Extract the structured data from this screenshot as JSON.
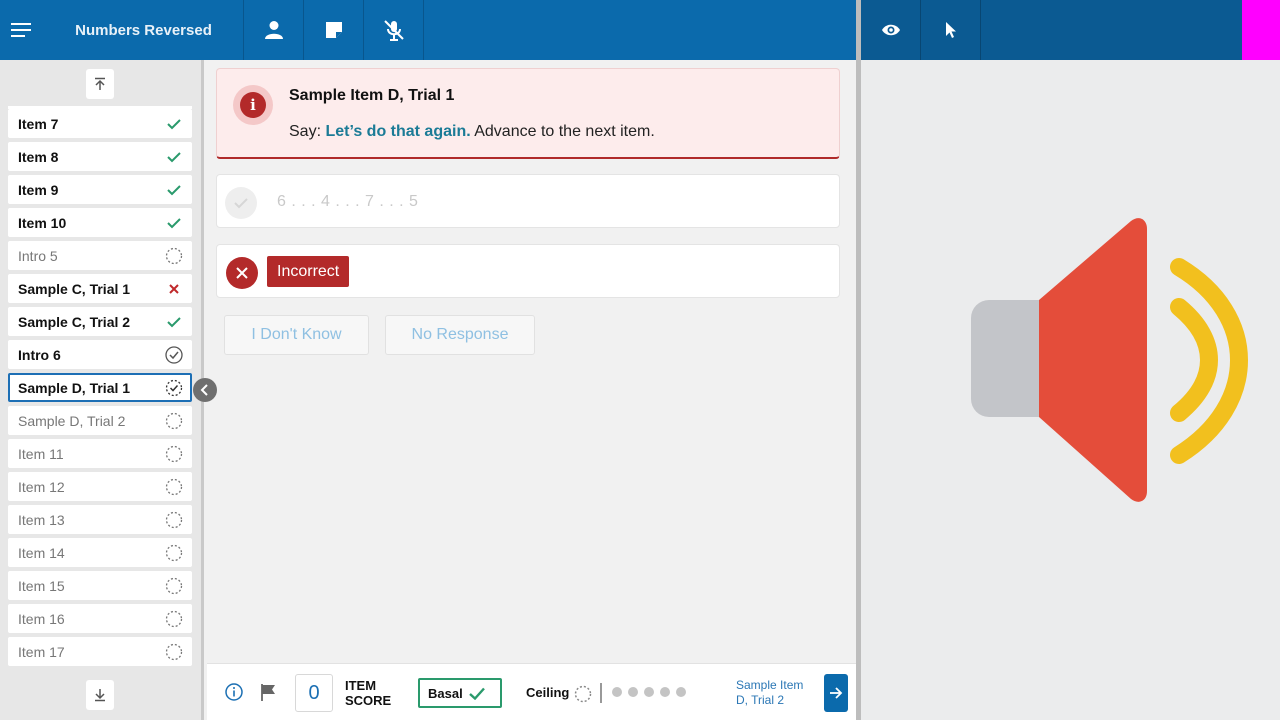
{
  "header": {
    "title": "Numbers Reversed"
  },
  "sidebar": {
    "items": [
      {
        "label": "Item 7",
        "status": "check",
        "style": "bold"
      },
      {
        "label": "Item 8",
        "status": "check",
        "style": "bold"
      },
      {
        "label": "Item 9",
        "status": "check",
        "style": "bold"
      },
      {
        "label": "Item 10",
        "status": "check",
        "style": "bold"
      },
      {
        "label": "Intro 5",
        "status": "pending",
        "style": "muted"
      },
      {
        "label": "Sample C, Trial 1",
        "status": "cross",
        "style": "bold"
      },
      {
        "label": "Sample C, Trial 2",
        "status": "check",
        "style": "bold"
      },
      {
        "label": "Intro 6",
        "status": "check-circle",
        "style": "bold"
      },
      {
        "label": "Sample D, Trial 1",
        "status": "in-progress",
        "style": "bold current"
      },
      {
        "label": "Sample D, Trial 2",
        "status": "pending",
        "style": "muted"
      },
      {
        "label": "Item 11",
        "status": "pending",
        "style": "muted"
      },
      {
        "label": "Item 12",
        "status": "pending",
        "style": "muted"
      },
      {
        "label": "Item 13",
        "status": "pending",
        "style": "muted"
      },
      {
        "label": "Item 14",
        "status": "pending",
        "style": "muted"
      },
      {
        "label": "Item 15",
        "status": "pending",
        "style": "muted"
      },
      {
        "label": "Item 16",
        "status": "pending",
        "style": "muted"
      },
      {
        "label": "Item 17",
        "status": "pending",
        "style": "muted"
      }
    ]
  },
  "alert": {
    "title": "Sample Item D, Trial 1",
    "say_prefix": "Say:",
    "say_text": "Let’s do that again.",
    "instruction": "Advance to the next item."
  },
  "response": {
    "sequence": "6 . . . 4 . . . 7 . . . 5"
  },
  "scoring": {
    "result_label": "Incorrect"
  },
  "buttons": {
    "dont_know": "I Don't Know",
    "no_response": "No Response"
  },
  "footer": {
    "item_score": "0",
    "item_score_label_1": "ITEM",
    "item_score_label_2": "SCORE",
    "basal_label": "Basal",
    "ceiling_label": "Ceiling",
    "next_item_line1": "Sample Item",
    "next_item_line2": "D, Trial 2"
  },
  "colors": {
    "primary": "#0b6aac",
    "danger": "#b32a2a",
    "success": "#2a9a6c",
    "speaker_body": "#e44d3a",
    "speaker_waves": "#f2c01e"
  }
}
